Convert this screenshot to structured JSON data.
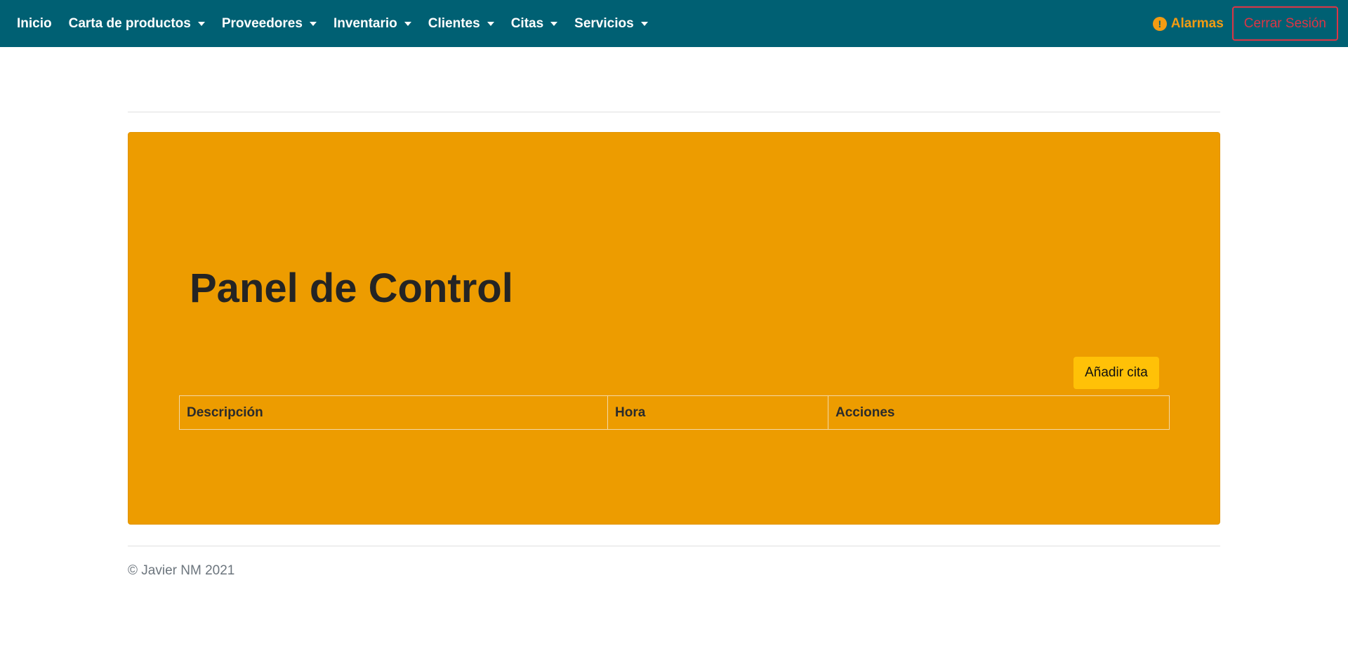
{
  "navbar": {
    "items": [
      {
        "label": "Inicio",
        "dropdown": false
      },
      {
        "label": "Carta de productos",
        "dropdown": true
      },
      {
        "label": "Proveedores",
        "dropdown": true
      },
      {
        "label": "Inventario",
        "dropdown": true
      },
      {
        "label": "Clientes",
        "dropdown": true
      },
      {
        "label": "Citas",
        "dropdown": true
      },
      {
        "label": "Servicios",
        "dropdown": true
      }
    ],
    "alarm_icon": "!",
    "alarm_label": "Alarmas",
    "logout_label": "Cerrar Sesión"
  },
  "panel": {
    "title": "Panel de Control",
    "add_button": "Añadir cita",
    "table": {
      "headers": [
        "Descripción",
        "Hora",
        "Acciones"
      ],
      "rows": []
    }
  },
  "footer": {
    "text": "© Javier NM 2021"
  },
  "colors": {
    "navbar_bg": "#006073",
    "panel_bg": "#ed9c00",
    "add_button_bg": "#ffc107",
    "alarm": "#f39c12",
    "logout": "#dc3545"
  }
}
